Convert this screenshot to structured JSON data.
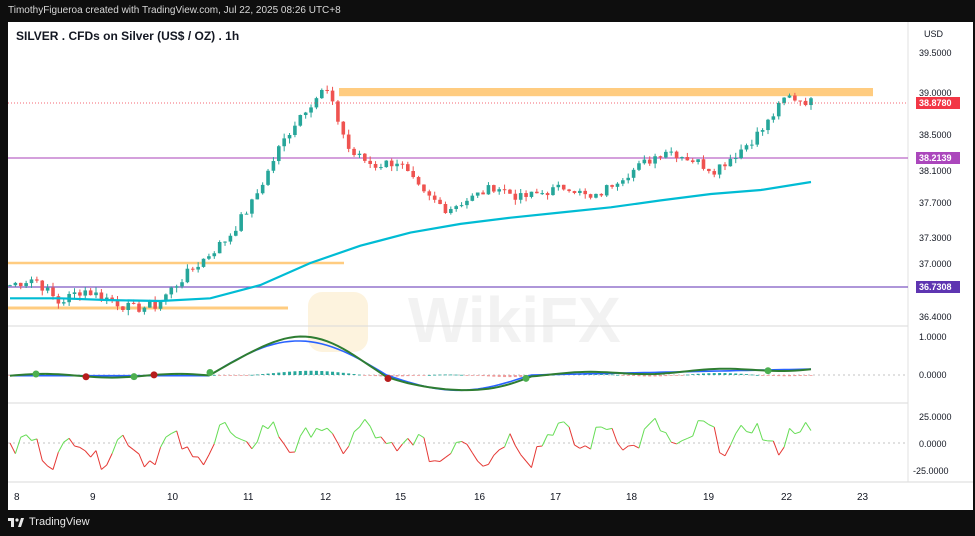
{
  "header": {
    "attribution": "TimothyFigueroa created with TradingView.com, Jul 22, 2025 08:26 UTC+8"
  },
  "chart": {
    "title": "SILVER . CFDs on Silver (US$ / OZ) . 1h",
    "currency": "USD",
    "price_ticks": [
      "39.5000",
      "39.0000",
      "38.5000",
      "38.1000",
      "37.7000",
      "37.3000",
      "37.0000",
      "36.4000"
    ],
    "price_marker": "38.8780",
    "level_marker_upper": "38.2139",
    "level_marker_lower": "36.7308",
    "macd_ticks": [
      "1.0000",
      "0.0000"
    ],
    "osc_ticks": [
      "25.0000",
      "0.0000",
      "-25.0000"
    ],
    "x_ticks": [
      "8",
      "9",
      "10",
      "11",
      "12",
      "15",
      "16",
      "17",
      "18",
      "19",
      "22",
      "23"
    ],
    "watermark": "WikiFX"
  },
  "colors": {
    "up": "#26a69a",
    "down": "#ef5350",
    "ma_line": "#00bcd4",
    "zone": "#ffcc80",
    "level_pink": "#ba68c8",
    "level_purple": "#7e57c2",
    "price_badge": "#f23645"
  },
  "footer": {
    "brand": "TradingView"
  },
  "chart_data": {
    "type": "candlestick",
    "x_labels": [
      "8",
      "9",
      "10",
      "11",
      "12",
      "15",
      "16",
      "17",
      "18",
      "19",
      "22",
      "23"
    ],
    "ylim": [
      36.3,
      39.6
    ],
    "series_estimate": [
      36.75,
      36.83,
      36.55,
      36.7,
      36.6,
      36.48,
      36.52,
      36.8,
      37.05,
      37.3,
      37.7,
      38.3,
      38.75,
      39.05,
      38.3,
      38.15,
      38.2,
      37.8,
      37.62,
      37.75,
      37.9,
      37.75,
      37.82,
      37.9,
      37.72,
      37.98,
      38.15,
      38.33,
      38.23,
      38.1,
      38.3,
      38.55,
      38.95,
      38.88
    ],
    "ma_estimate": [
      36.6,
      36.6,
      36.58,
      36.57,
      36.6,
      36.75,
      37.0,
      37.2,
      37.35,
      37.45,
      37.52,
      37.58,
      37.64,
      37.72,
      37.8,
      37.85,
      37.95
    ],
    "levels": [
      36.7308,
      38.2139
    ],
    "zones": [
      [
        38.95,
        39.05
      ],
      [
        36.98,
        37.02
      ],
      [
        36.47,
        36.51
      ]
    ]
  }
}
